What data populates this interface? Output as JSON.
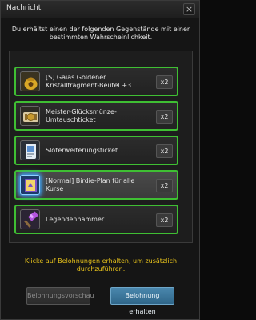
{
  "dialog": {
    "title": "Nachricht",
    "close_label": "×",
    "message": "Du erhältst einen der folgenden Gegenstände mit einer bestimmten Wahrscheinlichkeit.",
    "items": [
      {
        "name": "[S] Gaias Goldener Kristallfragment-Beutel +3",
        "qty": "x2",
        "icon": "golden-pouch-icon"
      },
      {
        "name": "Meister-Glücksmünze-Umtauschticket",
        "qty": "x2",
        "icon": "coin-ticket-icon"
      },
      {
        "name": "Sloterweiterungsticket",
        "qty": "x2",
        "icon": "slot-ticket-icon"
      },
      {
        "name": "[Normal] Birdie-Plan für alle Kurse",
        "qty": "x2",
        "icon": "birdie-plan-icon"
      },
      {
        "name": "Legendenhammer",
        "qty": "x2",
        "icon": "legend-hammer-icon"
      }
    ],
    "hint": "Klicke auf Belohnungen erhalten, um zusätzlich durchzuführen.",
    "preview_button": "Belohnungsvorschau",
    "receive_button": "Belohnung erhalten",
    "colors": {
      "item_border": "#3fbf33",
      "hint": "#e7c21b",
      "primary_button": "#3b77a0"
    }
  }
}
